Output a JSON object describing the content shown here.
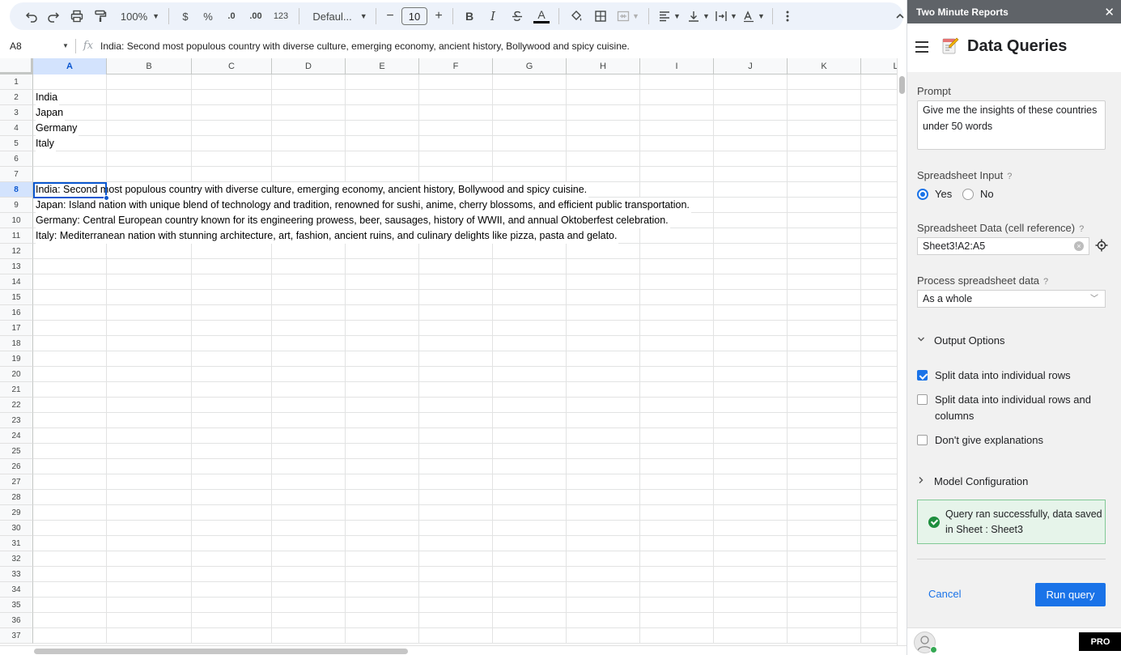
{
  "toolbar": {
    "zoom": "100%",
    "currency": "$",
    "percent": "%",
    "decrease_decimal": ".0",
    "increase_decimal": ".00",
    "number_format": "123",
    "font": "Defaul...",
    "font_size": "10",
    "minus": "−",
    "plus": "+",
    "bold": "B",
    "italic": "I",
    "text_color": "A"
  },
  "formula_bar": {
    "cell_ref": "A8",
    "fx": "fx",
    "content": "India: Second most populous country with diverse culture, emerging economy, ancient history, Bollywood and spicy cuisine."
  },
  "sheet": {
    "columns": [
      "A",
      "B",
      "C",
      "D",
      "E",
      "F",
      "G",
      "H",
      "I",
      "J",
      "K",
      "L"
    ],
    "selected_column": "A",
    "selected_row": 8,
    "row_count": 37,
    "cells": {
      "2": "India",
      "3": "Japan",
      "4": "Germany",
      "5": "Italy",
      "8": "India: Second most populous country with diverse culture, emerging economy, ancient history, Bollywood and spicy cuisine.",
      "9": "Japan: Island nation with unique blend of technology and tradition, renowned for sushi, anime, cherry blossoms, and efficient public transportation.",
      "10": "Germany: Central European country known for its engineering prowess, beer, sausages, history of WWII, and annual Oktoberfest celebration.",
      "11": "Italy: Mediterranean nation with stunning architecture, art, fashion, ancient ruins, and culinary delights like pizza, pasta and gelato."
    }
  },
  "sidebar": {
    "window_title": "Two Minute Reports",
    "close": "✕",
    "title": "Data Queries",
    "prompt_label": "Prompt",
    "prompt_value": "Give me the insights of these countries under 50 words",
    "spreadsheet_input_label": "Spreadsheet Input",
    "help": "?",
    "yes": "Yes",
    "no": "No",
    "spreadsheet_input_selected": "Yes",
    "cell_ref_label": "Spreadsheet Data (cell reference)",
    "cell_ref_value": "Sheet3!A2:A5",
    "clear": "×",
    "process_label": "Process spreadsheet data",
    "process_value": "As a whole",
    "output_options": "Output Options",
    "options": [
      {
        "label": "Split data into individual rows",
        "checked": true
      },
      {
        "label": "Split data into individual rows and columns",
        "checked": false
      },
      {
        "label": "Don't give explanations",
        "checked": false
      }
    ],
    "model_config": "Model Configuration",
    "success_message": "Query ran successfully, data saved in Sheet : Sheet3",
    "cancel": "Cancel",
    "run": "Run query",
    "pro": "PRO"
  },
  "colors": {
    "accent": "#1a73e8",
    "selection": "#0b57d0",
    "success_bg": "#e6f4ea",
    "titlebar": "#5f6368"
  }
}
